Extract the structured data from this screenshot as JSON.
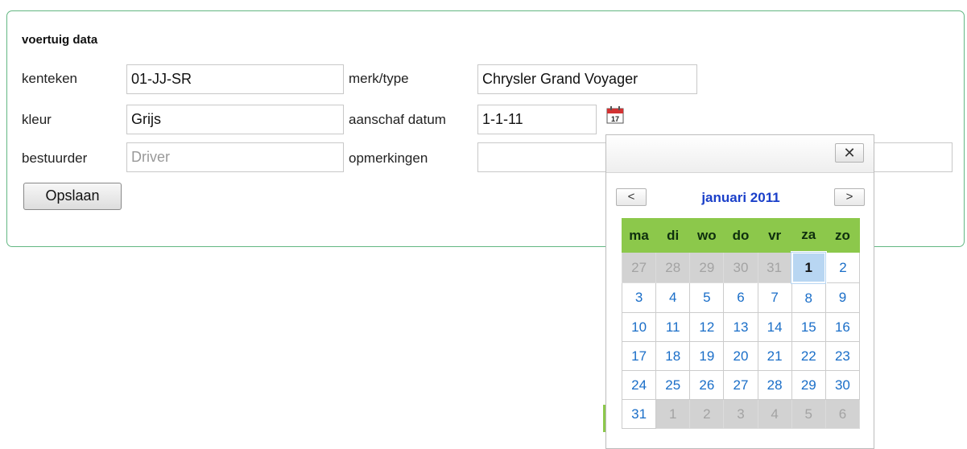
{
  "form": {
    "title": "voertuig data",
    "labels": {
      "kenteken": "kenteken",
      "merktype": "merk/type",
      "kleur": "kleur",
      "aanschaf": "aanschaf datum",
      "bestuurder": "bestuurder",
      "opmerkingen": "opmerkingen"
    },
    "values": {
      "kenteken": "01-JJ-SR",
      "merktype": "Chrysler Grand Voyager",
      "kleur": "Grijs",
      "aanschaf": "1-1-11",
      "bestuurder": "",
      "opmerkingen": ""
    },
    "placeholders": {
      "bestuurder": "Driver"
    },
    "save_label": "Opslaan",
    "calendar_icon": "calendar-icon",
    "calendar_icon_day": "17"
  },
  "datepicker": {
    "close_label": "✕",
    "prev_label": "<",
    "next_label": ">",
    "month_label": "januari 2011",
    "weekdays": [
      "ma",
      "di",
      "wo",
      "do",
      "vr",
      "za",
      "zo"
    ],
    "weeks": [
      [
        {
          "d": "27",
          "other": true
        },
        {
          "d": "28",
          "other": true
        },
        {
          "d": "29",
          "other": true
        },
        {
          "d": "30",
          "other": true
        },
        {
          "d": "31",
          "other": true
        },
        {
          "d": "1",
          "selected": true
        },
        {
          "d": "2"
        }
      ],
      [
        {
          "d": "3"
        },
        {
          "d": "4"
        },
        {
          "d": "5"
        },
        {
          "d": "6"
        },
        {
          "d": "7"
        },
        {
          "d": "8"
        },
        {
          "d": "9"
        }
      ],
      [
        {
          "d": "10"
        },
        {
          "d": "11"
        },
        {
          "d": "12"
        },
        {
          "d": "13"
        },
        {
          "d": "14"
        },
        {
          "d": "15"
        },
        {
          "d": "16"
        }
      ],
      [
        {
          "d": "17"
        },
        {
          "d": "18"
        },
        {
          "d": "19"
        },
        {
          "d": "20"
        },
        {
          "d": "21"
        },
        {
          "d": "22"
        },
        {
          "d": "23"
        }
      ],
      [
        {
          "d": "24"
        },
        {
          "d": "25"
        },
        {
          "d": "26"
        },
        {
          "d": "27"
        },
        {
          "d": "28"
        },
        {
          "d": "29"
        },
        {
          "d": "30"
        }
      ],
      [
        {
          "d": "31"
        },
        {
          "d": "1",
          "other": true
        },
        {
          "d": "2",
          "other": true
        },
        {
          "d": "3",
          "other": true
        },
        {
          "d": "4",
          "other": true
        },
        {
          "d": "5",
          "other": true
        },
        {
          "d": "6",
          "other": true
        }
      ]
    ]
  },
  "colors": {
    "panel_border": "#63b782",
    "header_green": "#8cc84b",
    "month_blue": "#1a3fc9",
    "day_blue": "#1a6ec8",
    "selected_bg": "#b8d6f2",
    "other_month_bg": "#d2d2d2"
  }
}
